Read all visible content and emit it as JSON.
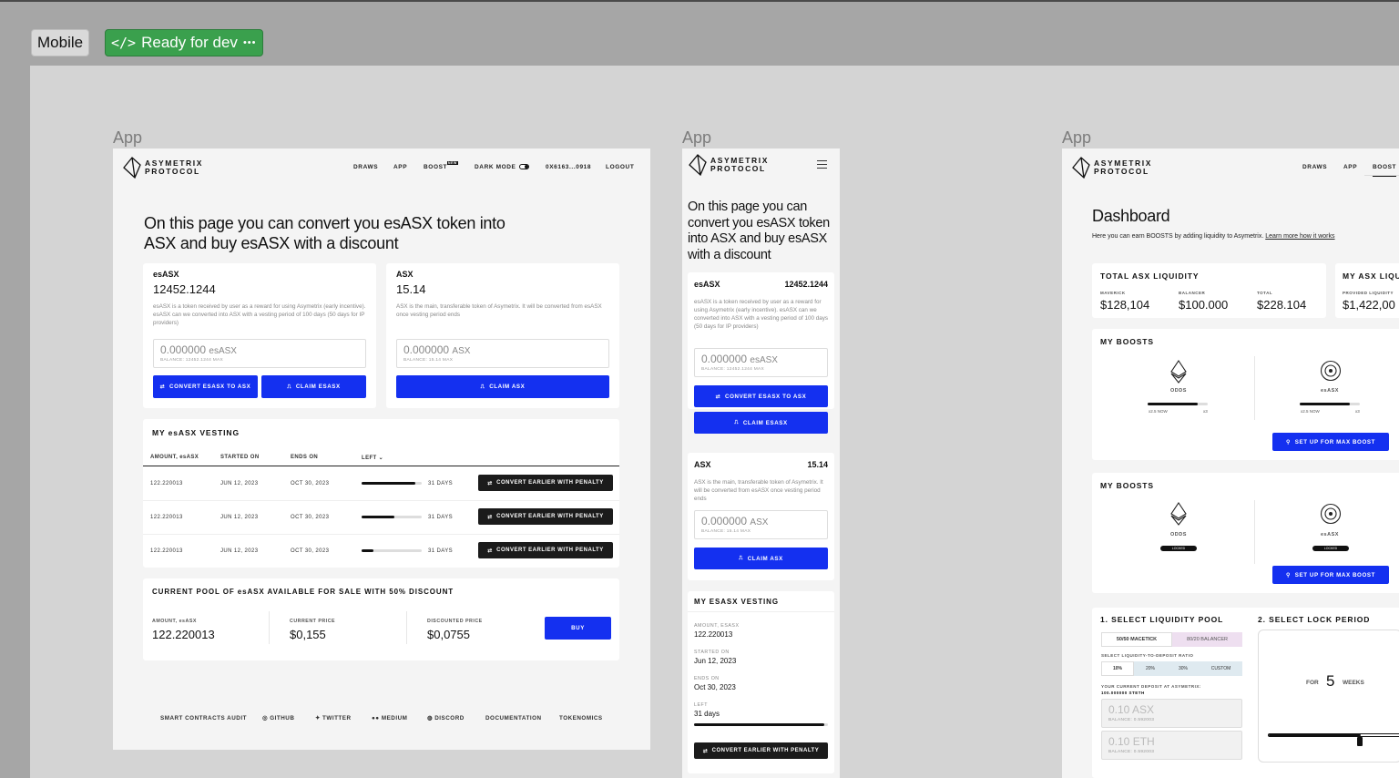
{
  "toolbar": {
    "mobile_label": "Mobile",
    "ready_label": "Ready for dev",
    "more": "•••"
  },
  "frames": {
    "left_label": "App",
    "middle_label": "App",
    "right_label": "App"
  },
  "brand": {
    "line1": "ASYMETRIX",
    "line2": "PROTOCOL",
    "accent": "#1430f0"
  },
  "nav": {
    "draws": "DRAWS",
    "app": "APP",
    "boost": "BOOST",
    "boost_badge": "NEW",
    "dark_mode": "DARK MODE",
    "wallet": "0X6163...0918",
    "logout": "LOGOUT"
  },
  "convert": {
    "heading": "On this page you can convert you esASX token into ASX and buy esASX with a discount",
    "esasx": {
      "title": "esASX",
      "value": "12452.1244",
      "desc": "esASX is a token received by user as a reward for using Asymetrix (early incentive). esASX can we converted into ASX with a vesting period of 100 days (50 days for IP providers)",
      "input_value": "0.000000",
      "input_unit": "esASX",
      "balance": "BALANCE: 12452.1244 MAX",
      "convert_btn": "CONVERT ESASX TO ASX",
      "claim_btn": "CLAIM ESASX"
    },
    "asx": {
      "title": "ASX",
      "value": "15.14",
      "desc": "ASX is the main, transferable token of Asymetrix. It will be converted from esASX once vesting period ends",
      "input_value": "0.000000",
      "input_unit": "ASX",
      "balance": "BALANCE: 15.14 MAX",
      "claim_btn": "CLAIM ASX"
    }
  },
  "vesting": {
    "title": "MY esASX VESTING",
    "headers": [
      "AMOUNT, esASX",
      "STARTED ON",
      "ENDS ON",
      "LEFT ⌄"
    ],
    "rows": [
      {
        "amount": "122.220013",
        "started": "JUN 12, 2023",
        "ends": "OCT 30, 2023",
        "left": "31 DAYS",
        "progress": 0.9,
        "action": "CONVERT EARLIER WITH PENALTY"
      },
      {
        "amount": "122.220013",
        "started": "JUN 12, 2023",
        "ends": "OCT 30, 2023",
        "left": "31 DAYS",
        "progress": 0.55,
        "action": "CONVERT EARLIER WITH PENALTY"
      },
      {
        "amount": "122.220013",
        "started": "JUN 12, 2023",
        "ends": "OCT 30, 2023",
        "left": "31 DAYS",
        "progress": 0.2,
        "action": "CONVERT EARLIER WITH PENALTY"
      }
    ]
  },
  "pool": {
    "title": "CURRENT POOL OF esASX AVAILABLE FOR SALE WITH 50% DISCOUNT",
    "amount_label": "AMOUNT, esASX",
    "amount": "122.220013",
    "price_label": "CURRENT PRICE",
    "price": "$0,155",
    "discount_label": "DISCOUNTED PRICE",
    "discount": "$0,0755",
    "buy": "BUY"
  },
  "footer": [
    "SMART CONTRACTS AUDIT",
    "GITHUB",
    "TWITTER",
    "MEDIUM",
    "DISCORD",
    "DOCUMENTATION",
    "TOKENOMICS"
  ],
  "mobile": {
    "heading": "On this page you can convert you esASX token into ASX and buy esASX with a discount",
    "esasx_title": "esASX",
    "esasx_value": "12452.1244",
    "esasx_desc": "esASX is a token received by user as a reward for using Asymetrix (early incentive). esASX can we converted into ASX with a vesting period of 100 days (50 days for IP providers)",
    "esasx_input": "0.000000",
    "esasx_unit": "esASX",
    "esasx_balance": "BALANCE: 12452.1244 MAX",
    "convert_btn": "CONVERT ESASX TO ASX",
    "claim_esasx_btn": "CLAIM ESASX",
    "asx_title": "ASX",
    "asx_value": "15.14",
    "asx_desc": "ASX is the main, transferable token of Asymetrix. It will be converted from esASX once vesting period ends",
    "asx_input": "0.000000",
    "asx_unit": "ASX",
    "asx_balance": "BALANCE: 15.14 MAX",
    "claim_asx_btn": "CLAIM ASX",
    "vesting_title": "MY ESASX VESTING",
    "amount_label": "AMOUNT, ESASX",
    "amount": "122.220013",
    "started_label": "STARTED ON",
    "started": "Jun 12, 2023",
    "ends_label": "ENDS ON",
    "ends": "Oct 30, 2023",
    "left_label": "LEFT",
    "left": "31 days",
    "left_progress": 0.97,
    "penalty_btn": "CONVERT EARLIER WITH PENALTY"
  },
  "dashboard": {
    "nav": {
      "draws": "DRAWS",
      "app": "APP",
      "boost": "BOOST"
    },
    "title": "Dashboard",
    "subtitle": "Here you can earn BOOSTS by adding liquidity to Asymetrix.",
    "subtitle_link": "Learn more how it works",
    "total": {
      "title": "TOTAL ASX LIQUIDITY",
      "maverick_label": "MAVERICK",
      "maverick": "$128,104",
      "balancer_label": "BALANCER",
      "balancer": "$100.000",
      "total_label": "TOTAL",
      "total": "$228.104"
    },
    "my_liq": {
      "title": "MY ASX LIQU",
      "label": "PROVIDED LIQUIDITY",
      "value": "$1,422,00"
    },
    "boosts1": {
      "title": "MY BOOSTS",
      "odds": "ODDS",
      "esasx": "esASX",
      "now": "x2.5 NOW",
      "max": "x3",
      "odds_progress": 0.83,
      "esasx_progress": 0.83,
      "setup": "SET UP FOR MAX BOOST"
    },
    "boosts2": {
      "title": "MY BOOSTS",
      "odds": "ODDS",
      "esasx": "esASX",
      "locked": "LOCKED",
      "setup": "SET UP FOR MAX BOOST"
    },
    "pool": {
      "title": "1. SELECT LIQUIDITY POOL",
      "opt1": "50/50 MACETICK",
      "opt2": "80/20 BALANCER",
      "ratio_label": "SELECT LIQUIDITY-TO-DEPOSIT RATIO",
      "ratios": [
        "10%",
        "20%",
        "30%",
        "CUSTOM"
      ],
      "deposit_label": "YOUR CURRENT DEPOSIT AT ASYMETRIX:",
      "deposit_value": "100.000000 STETH",
      "asx_input": "0.10 ASX",
      "asx_balance": "BALANCE: 0.592003",
      "eth_input": "0.10 ETH",
      "eth_balance": "BALANCE: 0.592003"
    },
    "lock": {
      "title": "2. SELECT LOCK PERIOD",
      "for": "FOR",
      "weeks_value": "5",
      "weeks": "WEEKS",
      "progress": 0.68
    }
  }
}
